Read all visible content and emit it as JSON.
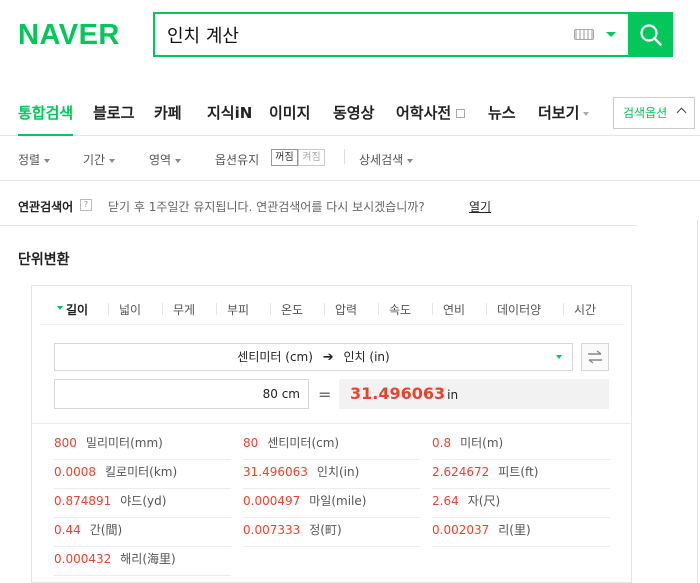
{
  "header": {
    "logo": "NAVER",
    "search_value": "인치 계산",
    "icons": {
      "keyboard": "keyboard-icon",
      "autocomplete": "chevron-down-icon",
      "search": "search-icon"
    },
    "accent": "#03c75a"
  },
  "tabs": {
    "items": [
      "통합검색",
      "블로그",
      "카페",
      "지식iN",
      "이미지",
      "동영상",
      "어학사전",
      "뉴스",
      "더보기"
    ],
    "options_button": "검색옵션"
  },
  "filters": {
    "sort": "정렬",
    "period": "기간",
    "area": "영역",
    "keep_option": "옵션유지",
    "toggle_off": "꺼짐",
    "toggle_on": "켜짐",
    "detail": "상세검색"
  },
  "related": {
    "label": "연관검색어",
    "help": "?",
    "message": "닫기 후 1주일간 유지됩니다. 연관검색어를 다시 보시겠습니까?",
    "open_link": "열기"
  },
  "converter": {
    "title": "단위변환",
    "categories": [
      "길이",
      "넓이",
      "무게",
      "부피",
      "온도",
      "압력",
      "속도",
      "연비",
      "데이터양",
      "시간"
    ],
    "active_category": "길이",
    "from_unit": "센티미터 (cm)",
    "to_unit": "인치 (in)",
    "input_value": "80 cm",
    "equals": "=",
    "result_value": "31.496063",
    "result_unit": "in",
    "result_color": "#e8432f",
    "results": [
      {
        "value": "800",
        "unit": "밀리미터(mm)"
      },
      {
        "value": "80",
        "unit": "센티미터(cm)"
      },
      {
        "value": "0.8",
        "unit": "미터(m)"
      },
      {
        "value": "0.0008",
        "unit": "킬로미터(km)"
      },
      {
        "value": "31.496063",
        "unit": "인치(in)"
      },
      {
        "value": "2.624672",
        "unit": "피트(ft)"
      },
      {
        "value": "0.874891",
        "unit": "야드(yd)"
      },
      {
        "value": "0.000497",
        "unit": "마일(mile)"
      },
      {
        "value": "2.64",
        "unit": "자(尺)"
      },
      {
        "value": "0.44",
        "unit": "간(間)"
      },
      {
        "value": "0.007333",
        "unit": "정(町)"
      },
      {
        "value": "0.002037",
        "unit": "리(里)"
      },
      {
        "value": "0.000432",
        "unit": "해리(海里)"
      }
    ]
  }
}
